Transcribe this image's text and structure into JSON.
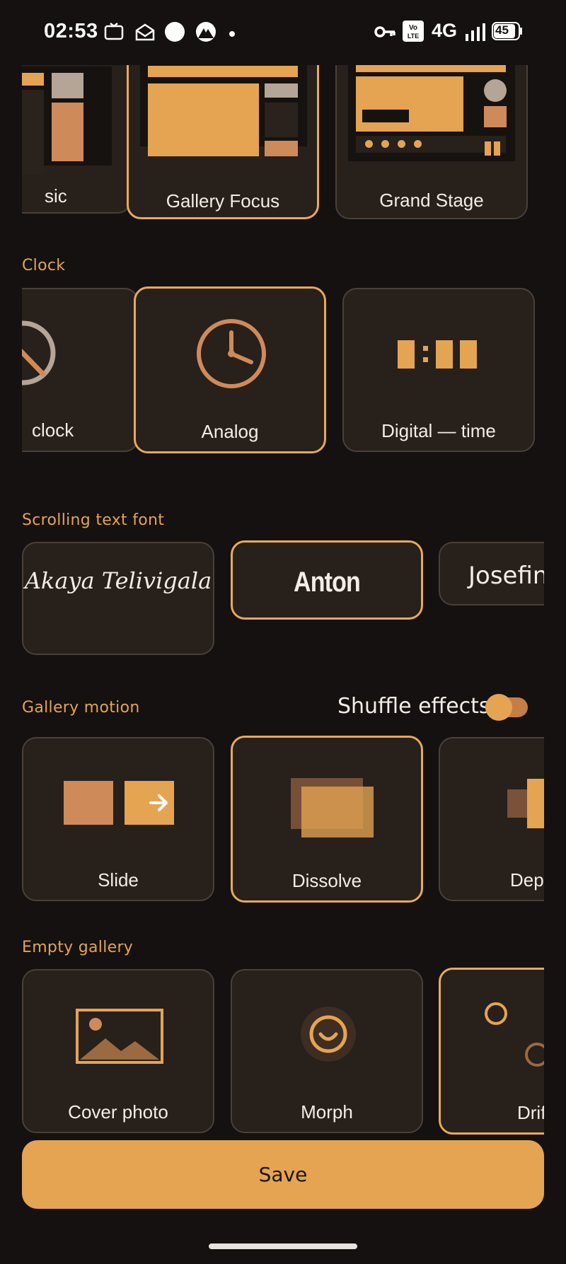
{
  "status_bar": {
    "time": "02:53",
    "network": "4G",
    "battery": "45",
    "icons": [
      "ome-tv-icon",
      "mail-icon",
      "circle-icon",
      "nordvpn-icon",
      "dot-icon",
      "vpn-key-icon",
      "volte-icon",
      "signal-icon",
      "battery-icon"
    ]
  },
  "layout_row": {
    "items": [
      {
        "label": "sic"
      },
      {
        "label": "Gallery Focus",
        "selected": true
      },
      {
        "label": "Grand Stage"
      }
    ]
  },
  "clock": {
    "title": "Clock",
    "items": [
      {
        "label": "clock"
      },
      {
        "label": "Analog",
        "selected": true
      },
      {
        "label": "Digital — time"
      }
    ]
  },
  "font": {
    "title": "Scrolling text font",
    "items": [
      {
        "label": "Akaya Telivigala"
      },
      {
        "label": "Anton",
        "selected": true
      },
      {
        "label": "Josefin"
      }
    ]
  },
  "gallery_motion": {
    "title": "Gallery motion",
    "shuffle_label": "Shuffle effects",
    "shuffle_on": true,
    "items": [
      {
        "label": "Slide"
      },
      {
        "label": "Dissolve",
        "selected": true
      },
      {
        "label": "Dept"
      }
    ]
  },
  "empty_gallery": {
    "title": "Empty gallery",
    "items": [
      {
        "label": "Cover photo"
      },
      {
        "label": "Morph"
      },
      {
        "label": "Drif",
        "selected": true
      }
    ]
  },
  "save_label": "Save",
  "colors": {
    "background": "#141110",
    "card": "#27201b",
    "accent": "#e4a452",
    "accent_dark": "#c47d44"
  }
}
